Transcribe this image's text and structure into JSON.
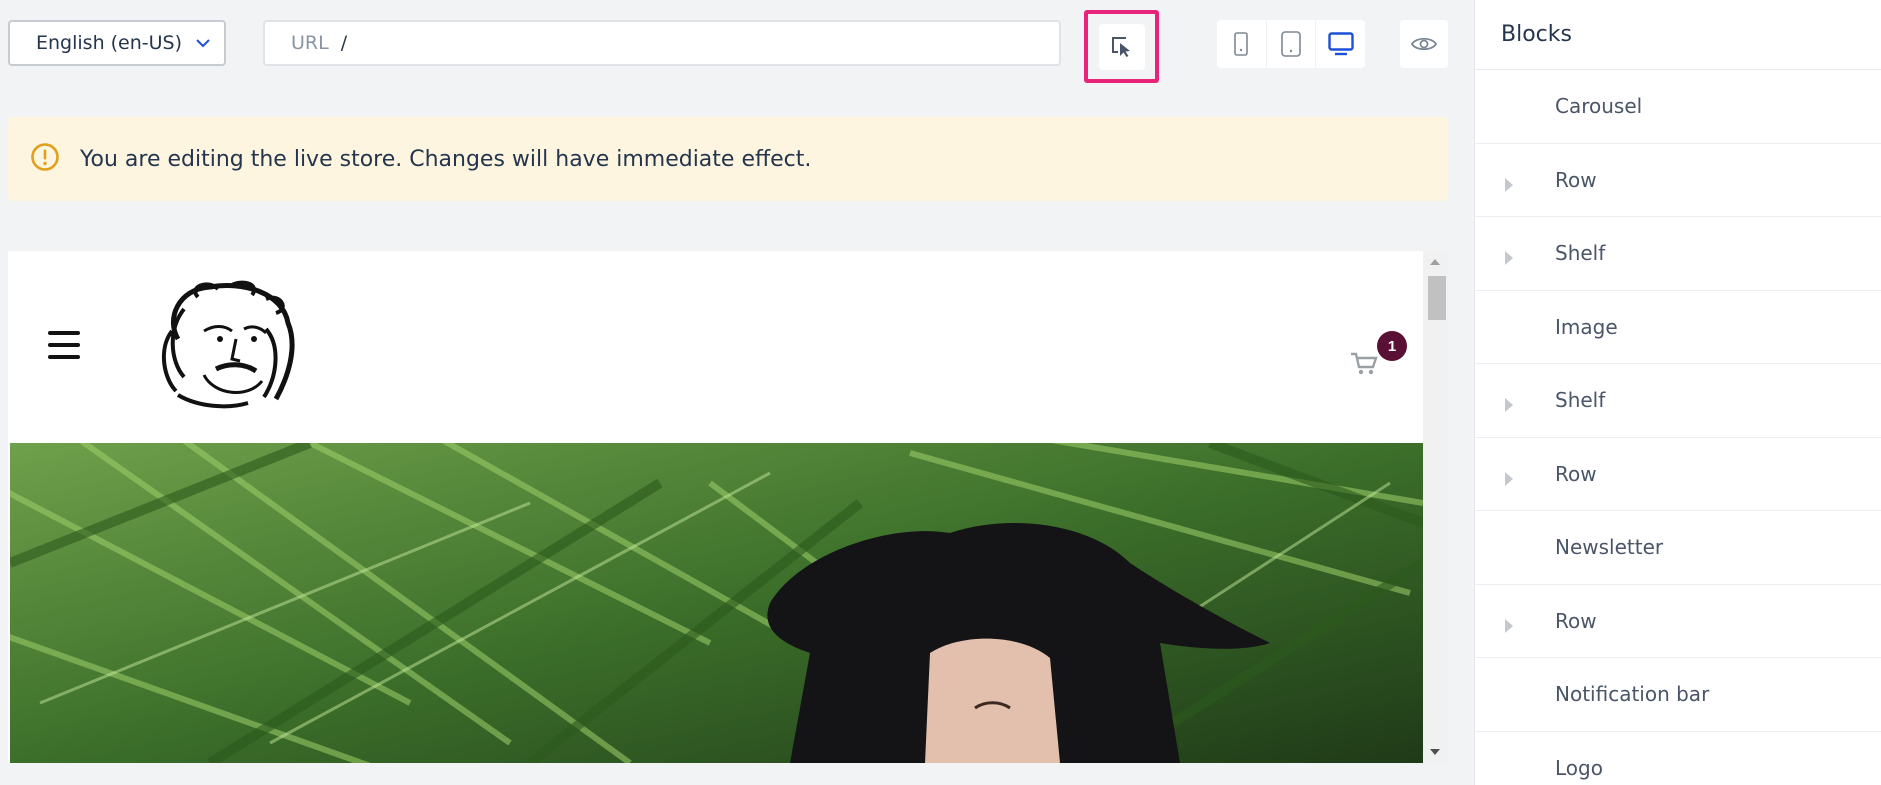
{
  "toolbar": {
    "locale": "English (en-US)",
    "url_label": "URL",
    "url_value": "/",
    "select_mode_icon": "cursor-select-icon",
    "devices": [
      "mobile-icon",
      "tablet-icon",
      "desktop-icon"
    ],
    "active_device": "desktop",
    "preview_icon": "eye-icon"
  },
  "warning": {
    "icon": "alert-circle-icon",
    "message": "You are editing the live store. Changes will have immediate effect."
  },
  "store": {
    "cart_count": "1",
    "hero_icon": "hero-image"
  },
  "sidebar": {
    "title": "Blocks",
    "items": [
      {
        "label": "Carousel",
        "expandable": false
      },
      {
        "label": "Row",
        "expandable": true
      },
      {
        "label": "Shelf",
        "expandable": true
      },
      {
        "label": "Image",
        "expandable": false
      },
      {
        "label": "Shelf",
        "expandable": true
      },
      {
        "label": "Row",
        "expandable": true
      },
      {
        "label": "Newsletter",
        "expandable": false
      },
      {
        "label": "Row",
        "expandable": true
      },
      {
        "label": "Notification bar",
        "expandable": false
      },
      {
        "label": "Logo",
        "expandable": false
      }
    ]
  },
  "colors": {
    "highlight": "#e8247a",
    "accent": "#1d4fd8",
    "warning_bg": "#fdf5e0",
    "warning_icon": "#e2a01a",
    "cart_badge": "#5a0f35"
  }
}
